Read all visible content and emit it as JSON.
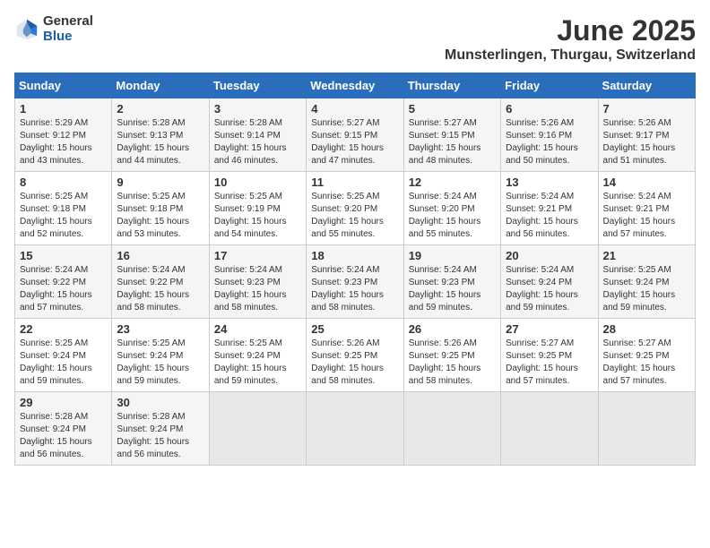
{
  "logo": {
    "general": "General",
    "blue": "Blue"
  },
  "title": "June 2025",
  "subtitle": "Munsterlingen, Thurgau, Switzerland",
  "headers": [
    "Sunday",
    "Monday",
    "Tuesday",
    "Wednesday",
    "Thursday",
    "Friday",
    "Saturday"
  ],
  "weeks": [
    [
      {
        "day": "1",
        "sunrise": "Sunrise: 5:29 AM",
        "sunset": "Sunset: 9:12 PM",
        "daylight": "Daylight: 15 hours and 43 minutes."
      },
      {
        "day": "2",
        "sunrise": "Sunrise: 5:28 AM",
        "sunset": "Sunset: 9:13 PM",
        "daylight": "Daylight: 15 hours and 44 minutes."
      },
      {
        "day": "3",
        "sunrise": "Sunrise: 5:28 AM",
        "sunset": "Sunset: 9:14 PM",
        "daylight": "Daylight: 15 hours and 46 minutes."
      },
      {
        "day": "4",
        "sunrise": "Sunrise: 5:27 AM",
        "sunset": "Sunset: 9:15 PM",
        "daylight": "Daylight: 15 hours and 47 minutes."
      },
      {
        "day": "5",
        "sunrise": "Sunrise: 5:27 AM",
        "sunset": "Sunset: 9:15 PM",
        "daylight": "Daylight: 15 hours and 48 minutes."
      },
      {
        "day": "6",
        "sunrise": "Sunrise: 5:26 AM",
        "sunset": "Sunset: 9:16 PM",
        "daylight": "Daylight: 15 hours and 50 minutes."
      },
      {
        "day": "7",
        "sunrise": "Sunrise: 5:26 AM",
        "sunset": "Sunset: 9:17 PM",
        "daylight": "Daylight: 15 hours and 51 minutes."
      }
    ],
    [
      {
        "day": "8",
        "sunrise": "Sunrise: 5:25 AM",
        "sunset": "Sunset: 9:18 PM",
        "daylight": "Daylight: 15 hours and 52 minutes."
      },
      {
        "day": "9",
        "sunrise": "Sunrise: 5:25 AM",
        "sunset": "Sunset: 9:18 PM",
        "daylight": "Daylight: 15 hours and 53 minutes."
      },
      {
        "day": "10",
        "sunrise": "Sunrise: 5:25 AM",
        "sunset": "Sunset: 9:19 PM",
        "daylight": "Daylight: 15 hours and 54 minutes."
      },
      {
        "day": "11",
        "sunrise": "Sunrise: 5:25 AM",
        "sunset": "Sunset: 9:20 PM",
        "daylight": "Daylight: 15 hours and 55 minutes."
      },
      {
        "day": "12",
        "sunrise": "Sunrise: 5:24 AM",
        "sunset": "Sunset: 9:20 PM",
        "daylight": "Daylight: 15 hours and 55 minutes."
      },
      {
        "day": "13",
        "sunrise": "Sunrise: 5:24 AM",
        "sunset": "Sunset: 9:21 PM",
        "daylight": "Daylight: 15 hours and 56 minutes."
      },
      {
        "day": "14",
        "sunrise": "Sunrise: 5:24 AM",
        "sunset": "Sunset: 9:21 PM",
        "daylight": "Daylight: 15 hours and 57 minutes."
      }
    ],
    [
      {
        "day": "15",
        "sunrise": "Sunrise: 5:24 AM",
        "sunset": "Sunset: 9:22 PM",
        "daylight": "Daylight: 15 hours and 57 minutes."
      },
      {
        "day": "16",
        "sunrise": "Sunrise: 5:24 AM",
        "sunset": "Sunset: 9:22 PM",
        "daylight": "Daylight: 15 hours and 58 minutes."
      },
      {
        "day": "17",
        "sunrise": "Sunrise: 5:24 AM",
        "sunset": "Sunset: 9:23 PM",
        "daylight": "Daylight: 15 hours and 58 minutes."
      },
      {
        "day": "18",
        "sunrise": "Sunrise: 5:24 AM",
        "sunset": "Sunset: 9:23 PM",
        "daylight": "Daylight: 15 hours and 58 minutes."
      },
      {
        "day": "19",
        "sunrise": "Sunrise: 5:24 AM",
        "sunset": "Sunset: 9:23 PM",
        "daylight": "Daylight: 15 hours and 59 minutes."
      },
      {
        "day": "20",
        "sunrise": "Sunrise: 5:24 AM",
        "sunset": "Sunset: 9:24 PM",
        "daylight": "Daylight: 15 hours and 59 minutes."
      },
      {
        "day": "21",
        "sunrise": "Sunrise: 5:25 AM",
        "sunset": "Sunset: 9:24 PM",
        "daylight": "Daylight: 15 hours and 59 minutes."
      }
    ],
    [
      {
        "day": "22",
        "sunrise": "Sunrise: 5:25 AM",
        "sunset": "Sunset: 9:24 PM",
        "daylight": "Daylight: 15 hours and 59 minutes."
      },
      {
        "day": "23",
        "sunrise": "Sunrise: 5:25 AM",
        "sunset": "Sunset: 9:24 PM",
        "daylight": "Daylight: 15 hours and 59 minutes."
      },
      {
        "day": "24",
        "sunrise": "Sunrise: 5:25 AM",
        "sunset": "Sunset: 9:24 PM",
        "daylight": "Daylight: 15 hours and 59 minutes."
      },
      {
        "day": "25",
        "sunrise": "Sunrise: 5:26 AM",
        "sunset": "Sunset: 9:25 PM",
        "daylight": "Daylight: 15 hours and 58 minutes."
      },
      {
        "day": "26",
        "sunrise": "Sunrise: 5:26 AM",
        "sunset": "Sunset: 9:25 PM",
        "daylight": "Daylight: 15 hours and 58 minutes."
      },
      {
        "day": "27",
        "sunrise": "Sunrise: 5:27 AM",
        "sunset": "Sunset: 9:25 PM",
        "daylight": "Daylight: 15 hours and 57 minutes."
      },
      {
        "day": "28",
        "sunrise": "Sunrise: 5:27 AM",
        "sunset": "Sunset: 9:25 PM",
        "daylight": "Daylight: 15 hours and 57 minutes."
      }
    ],
    [
      {
        "day": "29",
        "sunrise": "Sunrise: 5:28 AM",
        "sunset": "Sunset: 9:24 PM",
        "daylight": "Daylight: 15 hours and 56 minutes."
      },
      {
        "day": "30",
        "sunrise": "Sunrise: 5:28 AM",
        "sunset": "Sunset: 9:24 PM",
        "daylight": "Daylight: 15 hours and 56 minutes."
      },
      null,
      null,
      null,
      null,
      null
    ]
  ]
}
